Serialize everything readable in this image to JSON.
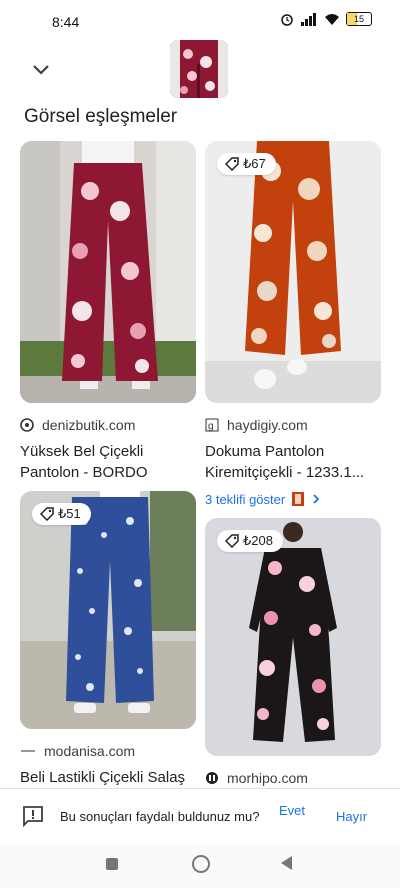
{
  "status": {
    "time": "8:44",
    "battery": "15"
  },
  "section_title": "Görsel eşleşmeler",
  "cards": [
    {
      "source": "denizbutik.com",
      "title": "Yüksek Bel Çiçekli Pantolon - BORDO"
    },
    {
      "price": "₺67",
      "source": "haydigiy.com",
      "title": "Dokuma Pantolon Kiremitçiçekli - 1233.1...",
      "offers": "3 teklifi göster"
    },
    {
      "price": "₺51",
      "source": "modanisa.com",
      "title": "Beli Lastikli Çiçekli Salaş Pantolon - İndig..."
    },
    {
      "price": "₺208",
      "source": "morhipo.com",
      "title": ""
    }
  ],
  "feedback": {
    "question": "Bu sonuçları faydalı buldunuz mu?",
    "yes": "Evet",
    "no": "Hayır"
  },
  "colors": {
    "accent": "#1a73e8",
    "bordo": "#8e1734",
    "orange": "#c2410c",
    "navy": "#2f4f9a"
  }
}
